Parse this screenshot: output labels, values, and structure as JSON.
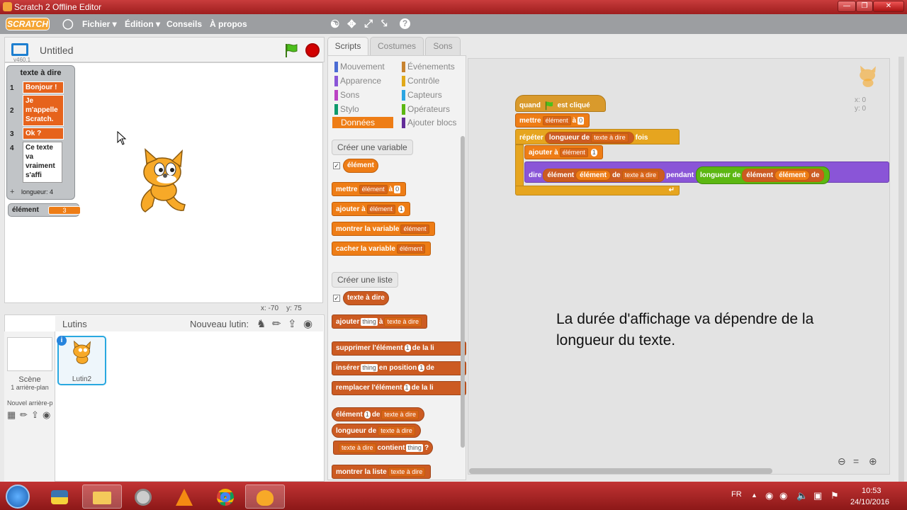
{
  "window": {
    "title": "Scratch 2 Offline Editor"
  },
  "menu": {
    "logo": "SCRATCH",
    "items": [
      "Fichier ▾",
      "Édition ▾",
      "Conseils",
      "À propos"
    ]
  },
  "stage": {
    "project_name": "Untitled",
    "version": "v460.1",
    "mouse_x": "x:  -70",
    "mouse_y": "y:  75"
  },
  "list_monitor": {
    "title": "texte à dire",
    "items": [
      {
        "idx": "1",
        "text": "Bonjour !"
      },
      {
        "idx": "2",
        "text": "Je m'appelle Scratch."
      },
      {
        "idx": "3",
        "text": "Ok ?"
      },
      {
        "idx": "4",
        "text": "Ce texte va vraiment s'affi"
      }
    ],
    "length_label": "longueur: 4"
  },
  "var_monitor": {
    "name": "élément",
    "value": "3"
  },
  "sprites": {
    "header": "Lutins",
    "new_sprite": "Nouveau lutin:",
    "scene_label": "Scène",
    "scene_sub": "1 arrière-plan",
    "new_backdrop": "Nouvel arrière-p",
    "sprite_name": "Lutin2",
    "info": "i"
  },
  "tabs": [
    "Scripts",
    "Costumes",
    "Sons"
  ],
  "categories": {
    "left": [
      {
        "label": "Mouvement",
        "color": "#4a6cd4"
      },
      {
        "label": "Apparence",
        "color": "#8a55d7"
      },
      {
        "label": "Sons",
        "color": "#bb42c3"
      },
      {
        "label": "Stylo",
        "color": "#0e9a6c"
      },
      {
        "label": "Données",
        "color": "#ee7d16"
      }
    ],
    "right": [
      {
        "label": "Événements",
        "color": "#c88330"
      },
      {
        "label": "Contrôle",
        "color": "#e1a91a"
      },
      {
        "label": "Capteurs",
        "color": "#2ca5e2"
      },
      {
        "label": "Opérateurs",
        "color": "#5cb712"
      },
      {
        "label": "Ajouter blocs",
        "color": "#632d99"
      }
    ]
  },
  "palette": {
    "make_var": "Créer une variable",
    "var_reporter": "élément",
    "set_block": {
      "a": "mettre",
      "var": "élément",
      "b": "à",
      "val": "0"
    },
    "change_block": {
      "a": "ajouter",
      "b": "à",
      "var": "élément",
      "val": "1"
    },
    "show_var": {
      "a": "montrer la variable",
      "var": "élément"
    },
    "hide_var": {
      "a": "cacher la variable",
      "var": "élément"
    },
    "make_list": "Créer une liste",
    "list_reporter": "texte à dire",
    "add_block": {
      "a": "ajouter",
      "thing": "thing",
      "b": "à",
      "list": "texte à dire"
    },
    "delete_block": {
      "a": "supprimer l'élément",
      "n": "1",
      "b": "de la li"
    },
    "insert_block": {
      "a": "insérer",
      "thing": "thing",
      "b": "en position",
      "n": "1",
      "c": "de"
    },
    "replace_block": {
      "a": "remplacer l'élément",
      "n": "1",
      "b": "de la li"
    },
    "item_block": {
      "a": "élément",
      "n": "1",
      "b": "de",
      "list": "texte à dire"
    },
    "length_block": {
      "a": "longueur de",
      "list": "texte à dire"
    },
    "contains_block": {
      "list": "texte à dire",
      "a": "contient",
      "thing": "thing",
      "q": "?"
    },
    "show_list": {
      "a": "montrer la liste",
      "list": "texte à dire"
    }
  },
  "script": {
    "hat": {
      "a": "quand",
      "b": "est cliqué"
    },
    "set": {
      "a": "mettre",
      "var": "élément",
      "b": "à",
      "val": "0"
    },
    "repeat": {
      "a": "répéter",
      "len": "longueur de",
      "list": "texte à dire",
      "b": "fois"
    },
    "change": {
      "a": "ajouter",
      "b": "à",
      "var": "élément",
      "val": "1"
    },
    "say": {
      "a": "dire",
      "item": "élément",
      "var": "élément",
      "de": "de",
      "list": "texte à dire",
      "pendant": "pendant",
      "len": "longueur de",
      "item2": "élément",
      "var2": "élément",
      "de2": "de"
    }
  },
  "sprite_coords": {
    "x": "x: 0",
    "y": "y: 0"
  },
  "annotation": "La durée d'affichage va dépendre de la longueur du texte.",
  "taskbar": {
    "lang": "FR",
    "time": "10:53",
    "date": "24/10/2016"
  },
  "colors": {
    "accent": "#ee7d16",
    "titlebar": "#b02828",
    "list_item": "#e6631c"
  }
}
